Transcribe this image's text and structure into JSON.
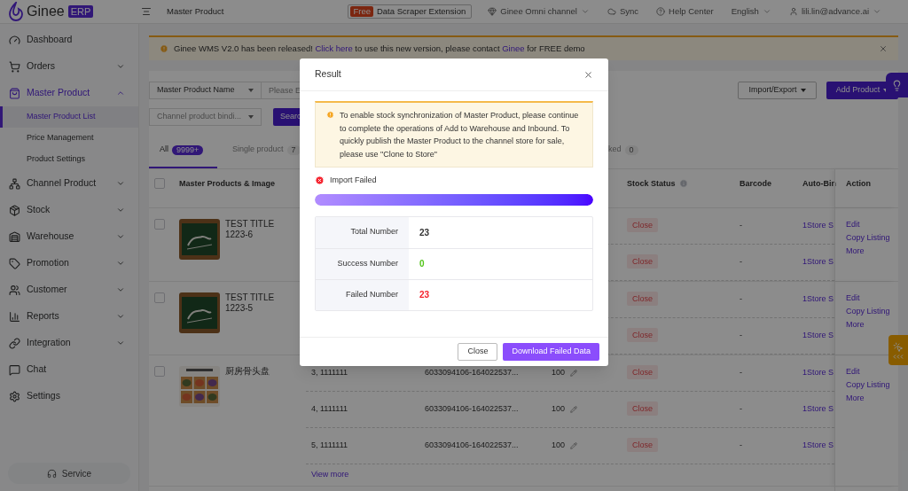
{
  "header": {
    "logo_text": "Ginee",
    "logo_badge": "ERP",
    "page_title": "Master Product",
    "extension": {
      "badge": "Free",
      "label": "Data Scraper Extension"
    },
    "nav": [
      {
        "kind": "dropdown",
        "label": "Ginee Omni channel"
      },
      {
        "kind": "plain",
        "label": "Sync"
      },
      {
        "kind": "plain",
        "label": "Help Center"
      },
      {
        "kind": "dropdown",
        "label": "English"
      },
      {
        "kind": "dropdown",
        "label": "lili.lin@advance.ai"
      }
    ]
  },
  "sidebar": {
    "items": [
      {
        "label": "Dashboard",
        "kind": "link",
        "selected": false
      },
      {
        "label": "Orders",
        "kind": "group",
        "expanded": false
      },
      {
        "label": "Master Product",
        "kind": "group",
        "expanded": true,
        "children": [
          {
            "label": "Master Product List",
            "selected": true
          },
          {
            "label": "Price Management",
            "selected": false
          },
          {
            "label": "Product Settings",
            "selected": false
          }
        ]
      },
      {
        "label": "Channel Product",
        "kind": "group",
        "expanded": false
      },
      {
        "label": "Stock",
        "kind": "group",
        "expanded": false
      },
      {
        "label": "Warehouse",
        "kind": "group",
        "expanded": false
      },
      {
        "label": "Promotion",
        "kind": "group",
        "expanded": false
      },
      {
        "label": "Customer",
        "kind": "group",
        "expanded": false
      },
      {
        "label": "Reports",
        "kind": "group",
        "expanded": false
      },
      {
        "label": "Integration",
        "kind": "group",
        "expanded": false
      },
      {
        "label": "Chat",
        "kind": "link",
        "selected": false
      },
      {
        "label": "Settings",
        "kind": "link",
        "selected": false
      }
    ],
    "service_button": "Service"
  },
  "banner": {
    "segments": [
      {
        "kind": "text",
        "text": "Ginee WMS V2.0 has been released!"
      },
      {
        "kind": "link",
        "text": "Click here"
      },
      {
        "kind": "text",
        "text": "to use this new version, please contact"
      },
      {
        "kind": "link",
        "text": "Ginee"
      },
      {
        "kind": "text",
        "text": "for FREE demo"
      }
    ]
  },
  "filters": {
    "field_select": "Master Product Name",
    "search_placeholder": "Please E",
    "binding_placeholder": "Channel product bindi...",
    "search_button": "Searc",
    "import_export": "Import/Export",
    "add_product": "Add Product"
  },
  "tabs": [
    {
      "label": "All",
      "count": "9999+",
      "selected": true
    },
    {
      "label": "Single product",
      "count": "7",
      "selected": false
    },
    {
      "label": "ked",
      "count": "0",
      "selected": false
    }
  ],
  "table": {
    "select_all_checked": false,
    "columns": [
      {
        "label": "Master Products & Image",
        "info": false
      },
      {
        "label": "Stock Status",
        "info": true
      },
      {
        "label": "Barcode",
        "info": false
      },
      {
        "label": "Auto-Bin",
        "info": false
      },
      {
        "label": "Action",
        "info": false
      }
    ],
    "rows": [
      {
        "title": "TEST TITLE 1223-6",
        "checked": false,
        "actions": [
          "Edit",
          "Copy Listing",
          "More"
        ],
        "variants": [
          {
            "status": "Close",
            "barcode": "-",
            "auto_bind": "1Store S"
          },
          {
            "status": "Close",
            "barcode": "-",
            "auto_bind": "1Store S"
          }
        ]
      },
      {
        "title": "TEST TITLE 1223-5",
        "checked": false,
        "actions": [
          "Edit",
          "Copy Listing",
          "More"
        ],
        "variants": [
          {
            "status": "Close",
            "barcode": "-",
            "auto_bind": "1Store S"
          },
          {
            "status": "Close",
            "barcode": "-",
            "auto_bind": "1Store S"
          }
        ]
      },
      {
        "title": "厨房骨头盘",
        "checked": false,
        "actions": [
          "Edit",
          "Copy Listing",
          "More"
        ],
        "view_more": "View more",
        "variants": [
          {
            "sku": "3, 1111111",
            "channel_id": "6033094106-164022537...",
            "stock": "100",
            "status": "Close",
            "barcode": "-",
            "auto_bind": "1Store S"
          },
          {
            "sku": "4, 1111111",
            "channel_id": "6033094106-164022537...",
            "stock": "100",
            "status": "Close",
            "barcode": "-",
            "auto_bind": "1Store S"
          },
          {
            "sku": "5, 1111111",
            "channel_id": "6033094106-164022537...",
            "stock": "100",
            "status": "Close",
            "barcode": "-",
            "auto_bind": "1Store S"
          }
        ]
      }
    ]
  },
  "modal": {
    "title": "Result",
    "notice": "To enable stock synchronization of Master Product, please continue to complete the operations of Add to Warehouse and Inbound. To quickly publish the Master Product to the channel store for sale, please use \"Clone to Store\"",
    "status": "Import Failed",
    "progress": {
      "level": 1
    },
    "stats": [
      {
        "label": "Total Number",
        "value": "23",
        "color": "#333333"
      },
      {
        "label": "Success Number",
        "value": "0",
        "color": "#52c41a"
      },
      {
        "label": "Failed Number",
        "value": "23",
        "color": "#f5222d"
      }
    ],
    "buttons": [
      {
        "kind": "secondary",
        "label": "Close"
      },
      {
        "kind": "primary",
        "label": "Download Failed Data"
      }
    ]
  }
}
